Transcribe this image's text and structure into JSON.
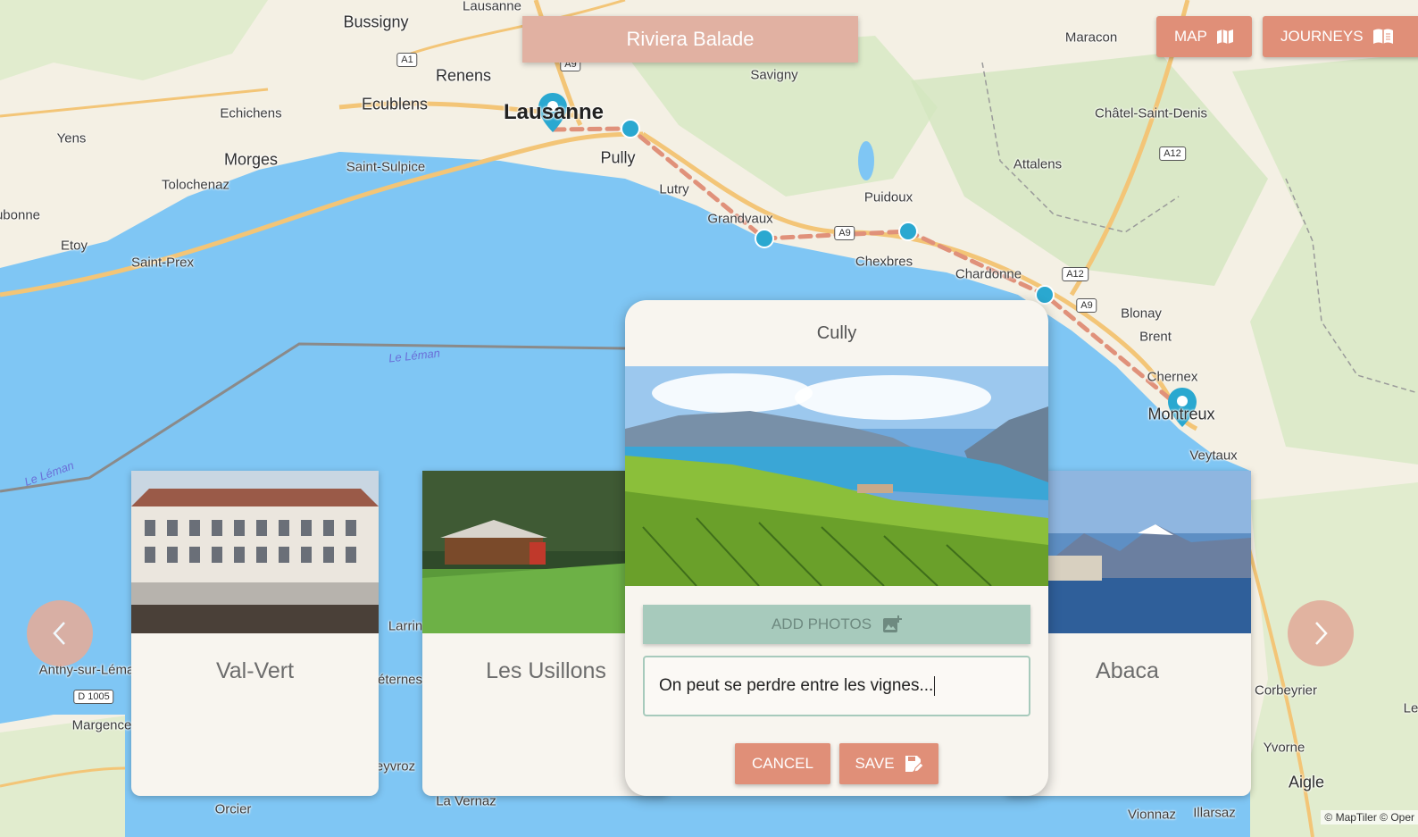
{
  "header": {
    "title": "Riviera Balade"
  },
  "nav": {
    "map_label": "MAP",
    "journeys_label": "JOURNEYS"
  },
  "map": {
    "labels": {
      "lausanne_top": "Lausanne",
      "bussigny": "Bussigny",
      "renens": "Renens",
      "ecublens": "Ecublens",
      "echichens": "Echichens",
      "yens": "Yens",
      "morges": "Morges",
      "saint_sulpice": "Saint-Sulpice",
      "tolochenaz": "Tolochenaz",
      "aubonne": "ubonne",
      "etoy": "Etoy",
      "saint_prex": "Saint-Prex",
      "lausanne": "Lausanne",
      "pully": "Pully",
      "savigny": "Savigny",
      "lutry": "Lutry",
      "grandvaux": "Grandvaux",
      "puidoux": "Puidoux",
      "chexbres": "Chexbres",
      "chardonne": "Chardonne",
      "maracon": "Maracon",
      "chatel": "Châtel-Saint-Denis",
      "attalens": "Attalens",
      "blonay": "Blonay",
      "brent": "Brent",
      "chernex": "Chernex",
      "montreux": "Montreux",
      "veytaux": "Veytaux",
      "corbeyrier": "Corbeyrier",
      "yvorne": "Yvorne",
      "aigle": "Aigle",
      "vionnaz": "Vionnaz",
      "illarsaz": "Illarsaz",
      "anthy": "Anthy-sur-Léma",
      "margence": "Margence",
      "orcier": "Orcier",
      "la_vernaz": "La Vernaz",
      "larrin": "Larrin",
      "feternes": "éternes",
      "evyroz": "eyvroz",
      "leman1": "Le Léman",
      "leman2": "Le Léman",
      "le": "Le"
    },
    "shields": {
      "a1": "A1",
      "a9_top": "A9",
      "a9_mid": "A9",
      "a9_low": "A9",
      "a12_top": "A12",
      "a12_low": "A12",
      "d1005": "D 1005"
    },
    "attribution": "© MapTiler © Oper"
  },
  "cards": [
    {
      "name": "Val-Vert"
    },
    {
      "name": "Les Usillons"
    },
    {
      "name": "Abaca"
    }
  ],
  "modal": {
    "title": "Cully",
    "add_photos_label": "ADD PHOTOS",
    "note_value": "On peut se perdre entre les vignes...",
    "cancel_label": "CANCEL",
    "save_label": "SAVE"
  },
  "colors": {
    "accent": "#e08f78",
    "title_bar": "#e1b1a2",
    "lake": "#7fc6f4",
    "route": "#e0917a",
    "waypoint": "#2aa8d0",
    "green_button": "#a7cabc"
  }
}
